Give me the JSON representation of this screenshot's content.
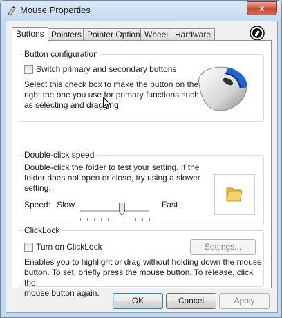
{
  "window": {
    "title": "Mouse Properties",
    "close_label": "x"
  },
  "tabs": [
    {
      "label": "Buttons",
      "active": true
    },
    {
      "label": "Pointers",
      "active": false
    },
    {
      "label": "Pointer Options",
      "active": false
    },
    {
      "label": "Wheel",
      "active": false
    },
    {
      "label": "Hardware",
      "active": false
    }
  ],
  "button_configuration": {
    "group_label": "Button configuration",
    "checkbox_label": "Switch primary and secondary buttons",
    "checked": false,
    "description_lines": [
      "Select this check box to make the button on the",
      "right the one you use for primary functions such",
      "as selecting and dragging."
    ]
  },
  "double_click": {
    "group_label": "Double-click speed",
    "description_lines": [
      "Double-click the folder to test your setting. If the",
      "folder does not open or close, try using a slower",
      "setting."
    ],
    "speed_label": "Speed:",
    "slow_label": "Slow",
    "fast_label": "Fast",
    "slider_level_fraction": 0.6
  },
  "clicklock": {
    "group_label": "ClickLock",
    "checkbox_label": "Turn on ClickLock",
    "checked": false,
    "settings_label": "Settings...",
    "description_lines": [
      "Enables you to highlight or drag without holding down the mouse",
      "button. To set, briefly press the mouse button. To release, click the",
      "mouse button again."
    ]
  },
  "footer": {
    "ok_label": "OK",
    "cancel_label": "Cancel",
    "apply_label": "Apply"
  },
  "colors": {
    "accent_blue": "#3c7fb1",
    "folder_yellow": "#f2c84b"
  }
}
